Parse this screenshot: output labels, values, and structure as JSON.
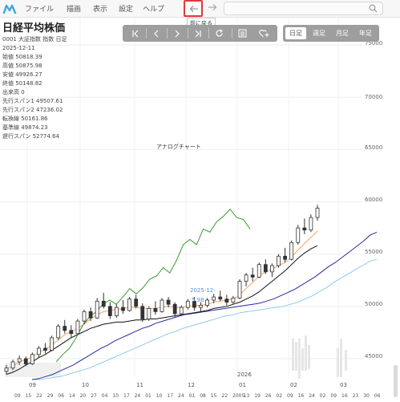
{
  "menu": {
    "items": [
      "ファイル",
      "描画",
      "表示",
      "設定",
      "ヘルプ"
    ],
    "back_tooltip": "前に戻る",
    "search_placeholder": ""
  },
  "toolbar": {
    "buttons": [
      "first-icon",
      "prev-icon",
      "next-icon",
      "last-icon",
      "reload-icon",
      "list-icon",
      "favorite-add-icon"
    ]
  },
  "period_tabs": [
    "日足",
    "週足",
    "月足",
    "年足"
  ],
  "active_period": "日足",
  "info": {
    "name": "日経平均株価",
    "code_line": "0001 大証指数 指数 日足",
    "date": "2025-12-11",
    "lines": [
      "始値 50818.39",
      "高値 50875.98",
      "安値 49926.27",
      "終値 50148.82",
      "出来高 0",
      "先行スパン1 49507.61",
      "先行スパン2 47236.02",
      "転換線 50161.86",
      "基準線 49874.23",
      "遅行スパン 52774.64"
    ]
  },
  "analog_label": "アナログチャート",
  "cursor_labels": [
    "2025-12-",
    "5.98"
  ],
  "colors": {
    "accent_red": "#e03a3a",
    "toolbar_bg": "#9e9e9e",
    "candle": "#333333",
    "tenkan": "#f4a261",
    "kijun": "#111111",
    "chikou": "#3a9b2f",
    "span1": "#2b2b9e",
    "span2": "#8ecbe8"
  },
  "chart_data": {
    "type": "line",
    "y_ticks": [
      "75000",
      "70000",
      "65000",
      "60000",
      "55000",
      "50000",
      "45000"
    ],
    "ylim": [
      43000,
      77000
    ],
    "x_ticks": [
      "09",
      "15",
      "22",
      "29",
      "06",
      "14",
      "20",
      "27",
      "04",
      "10",
      "17",
      "24",
      "01",
      "10",
      "17",
      "24",
      "01",
      "08",
      "15",
      "22",
      "2005",
      "13",
      "19",
      "26",
      "02",
      "09",
      "16",
      "24",
      "02",
      "09",
      "16",
      "23",
      "30",
      "06"
    ],
    "x_year_labels": [
      "09",
      "10",
      "11",
      "12",
      "2026",
      "01",
      "02",
      "03"
    ],
    "candles": [
      [
        43800,
        44400,
        43500,
        44100
      ],
      [
        44100,
        44900,
        43900,
        44700
      ],
      [
        44700,
        45300,
        44400,
        45000
      ],
      [
        45000,
        45200,
        44300,
        44500
      ],
      [
        44500,
        45600,
        44400,
        45400
      ],
      [
        45400,
        46200,
        45100,
        46000
      ],
      [
        46000,
        46500,
        45500,
        45800
      ],
      [
        45800,
        47200,
        45700,
        47000
      ],
      [
        47000,
        48300,
        46800,
        48100
      ],
      [
        48100,
        48700,
        47400,
        47700
      ],
      [
        47700,
        48200,
        47000,
        47400
      ],
      [
        47400,
        48800,
        47300,
        48600
      ],
      [
        48600,
        49700,
        48300,
        49500
      ],
      [
        49500,
        49900,
        48600,
        48900
      ],
      [
        48900,
        50800,
        48800,
        50500
      ],
      [
        50500,
        51300,
        49800,
        50000
      ],
      [
        50000,
        50400,
        48800,
        49100
      ],
      [
        49100,
        50200,
        48900,
        49900
      ],
      [
        49900,
        50600,
        49300,
        49600
      ],
      [
        49600,
        50900,
        49500,
        50700
      ],
      [
        50700,
        51100,
        49800,
        50000
      ],
      [
        50000,
        50300,
        48500,
        48800
      ],
      [
        48800,
        50000,
        48600,
        49800
      ],
      [
        49800,
        50500,
        49200,
        49500
      ],
      [
        49500,
        50800,
        49400,
        50600
      ],
      [
        50600,
        50900,
        49900,
        50200
      ],
      [
        50200,
        50400,
        49000,
        49300
      ],
      [
        49300,
        50100,
        49100,
        49900
      ],
      [
        49900,
        50700,
        49700,
        50500
      ],
      [
        50500,
        50900,
        49600,
        49900
      ],
      [
        49900,
        50400,
        49400,
        50100
      ],
      [
        50100,
        50800,
        49900,
        50600
      ],
      [
        50600,
        51200,
        50300,
        50900
      ],
      [
        50900,
        51500,
        50500,
        50700
      ],
      [
        50700,
        51100,
        50100,
        50400
      ],
      [
        50400,
        51000,
        50200,
        50800
      ],
      [
        50800,
        52600,
        50700,
        52400
      ],
      [
        52400,
        53200,
        51900,
        53000
      ],
      [
        53000,
        53700,
        52400,
        52800
      ],
      [
        52800,
        54200,
        52700,
        54000
      ],
      [
        54000,
        54500,
        53100,
        53300
      ],
      [
        53300,
        54100,
        52800,
        53900
      ],
      [
        53900,
        55000,
        53700,
        54800
      ],
      [
        54800,
        55600,
        54200,
        54500
      ],
      [
        54500,
        56300,
        54400,
        56100
      ],
      [
        56100,
        57800,
        55900,
        57500
      ],
      [
        57500,
        58400,
        56900,
        57300
      ],
      [
        57300,
        58800,
        57100,
        58500
      ],
      [
        58500,
        59700,
        58200,
        59400
      ]
    ],
    "tenkan": [
      44000,
      44300,
      44700,
      44900,
      45200,
      45600,
      45900,
      46300,
      46800,
      47300,
      47600,
      47900,
      48300,
      48800,
      49200,
      49500,
      49600,
      49700,
      49800,
      49900,
      49900,
      49800,
      49800,
      49800,
      49900,
      50000,
      49900,
      49900,
      50000,
      50100,
      50100,
      50200,
      50400,
      50500,
      50600,
      50700,
      51100,
      51700,
      52300,
      52900,
      53300,
      53600,
      53900,
      54200,
      54700,
      55400,
      56000,
      56600,
      57200
    ],
    "kijun": [
      43500,
      43700,
      44000,
      44400,
      44700,
      45100,
      45400,
      45800,
      46200,
      46600,
      47000,
      47300,
      47600,
      47900,
      48100,
      48300,
      48400,
      48500,
      48500,
      48600,
      48700,
      48700,
      48800,
      48800,
      48900,
      49000,
      49100,
      49200,
      49300,
      49400,
      49500,
      49600,
      49800,
      49900,
      50000,
      50200,
      50400,
      50700,
      51000,
      51400,
      51900,
      52400,
      52900,
      53400,
      54000,
      54600,
      55100,
      55500,
      55800
    ],
    "chikou": [
      44700,
      45400,
      46000,
      47000,
      48200,
      49000,
      49500,
      50200,
      50600,
      50200,
      50900,
      51700,
      51200,
      51800,
      52600,
      52900,
      53700,
      53200,
      54400,
      55900,
      56400,
      55900,
      57400,
      57100,
      58100,
      58600,
      59300,
      58500,
      58300,
      57400
    ],
    "span1": [
      43000,
      43100,
      43300,
      43500,
      43800,
      44100,
      44400,
      44800,
      45200,
      45600,
      46000,
      46300,
      46700,
      47000,
      47300,
      47600,
      47900,
      48100,
      48400,
      48600,
      48800,
      49000,
      49200,
      49300,
      49400,
      49500,
      49600,
      49700,
      49800,
      49900,
      50000,
      50100,
      50200,
      50300,
      50500,
      50700,
      51000,
      51300,
      51600,
      52000,
      52400,
      52800,
      53300,
      53800,
      54200,
      54700,
      55200,
      55700,
      56200,
      56800,
      57100
    ],
    "span2": [
      43000,
      43000,
      43100,
      43200,
      43300,
      43500,
      43700,
      43900,
      44100,
      44400,
      44700,
      45000,
      45300,
      45600,
      45900,
      46200,
      46500,
      46800,
      47100,
      47400,
      47600,
      47900,
      48100,
      48300,
      48500,
      48700,
      48900,
      49100,
      49200,
      49400,
      49500,
      49600,
      49700,
      49800,
      49900,
      50000,
      50200,
      50400,
      50700,
      51000,
      51400,
      51800,
      52300,
      52700,
      53100,
      53500,
      53900,
      54300,
      54500
    ]
  }
}
